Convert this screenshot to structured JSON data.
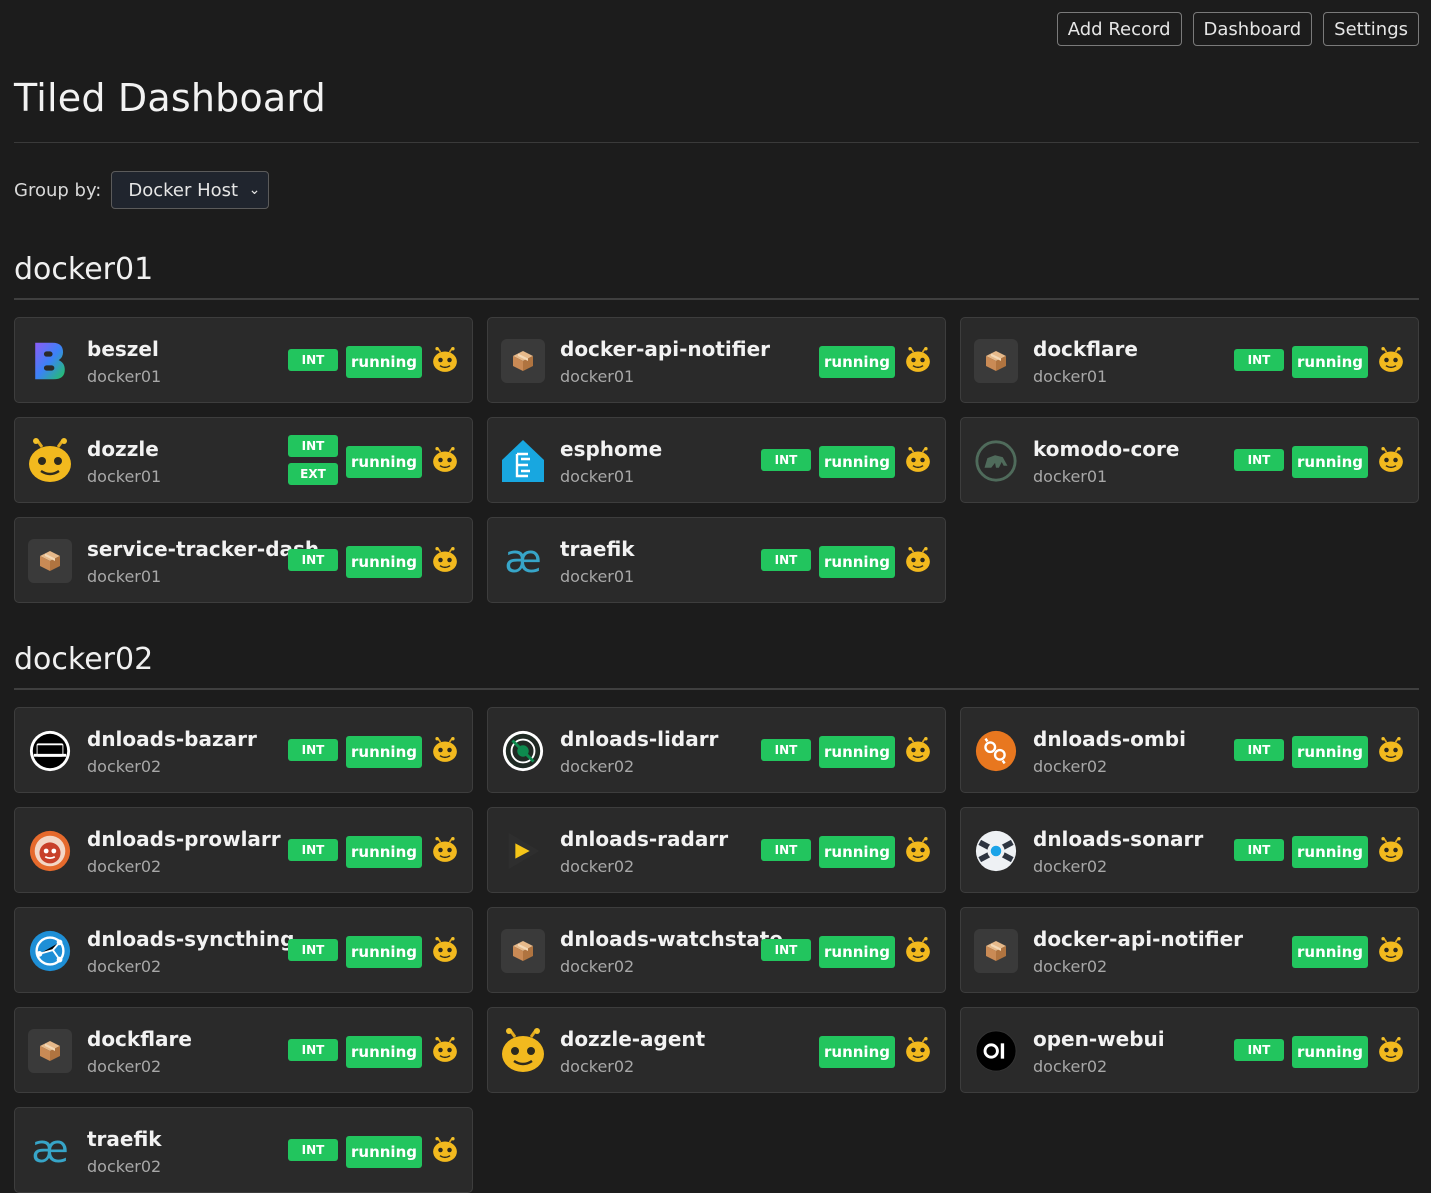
{
  "nav": {
    "add_record": "Add Record",
    "dashboard": "Dashboard",
    "settings": "Settings"
  },
  "page": {
    "title": "Tiled Dashboard"
  },
  "group_by": {
    "label": "Group by:",
    "value": "Docker Host"
  },
  "colors": {
    "accent_green": "#22c55e",
    "background": "#1c1c1c",
    "card": "#2a2a2a"
  },
  "groups": [
    {
      "title": "docker01",
      "cards": [
        {
          "name": "beszel",
          "host": "docker01",
          "icon": "beszel-icon",
          "tags": [
            "INT"
          ],
          "status": "running"
        },
        {
          "name": "docker-api-notifier",
          "host": "docker01",
          "icon": "package-icon",
          "tags": [],
          "status": "running"
        },
        {
          "name": "dockflare",
          "host": "docker01",
          "icon": "package-icon",
          "tags": [
            "INT"
          ],
          "status": "running"
        },
        {
          "name": "dozzle",
          "host": "docker01",
          "icon": "dozzle-icon",
          "tags": [
            "INT",
            "EXT"
          ],
          "status": "running"
        },
        {
          "name": "esphome",
          "host": "docker01",
          "icon": "esphome-icon",
          "tags": [
            "INT"
          ],
          "status": "running"
        },
        {
          "name": "komodo-core",
          "host": "docker01",
          "icon": "komodo-icon",
          "tags": [
            "INT"
          ],
          "status": "running"
        },
        {
          "name": "service-tracker-dash",
          "host": "docker01",
          "icon": "package-icon",
          "tags": [
            "INT"
          ],
          "status": "running"
        },
        {
          "name": "traefik",
          "host": "docker01",
          "icon": "traefik-icon",
          "tags": [
            "INT"
          ],
          "status": "running"
        }
      ]
    },
    {
      "title": "docker02",
      "cards": [
        {
          "name": "dnloads-bazarr",
          "host": "docker02",
          "icon": "bazarr-icon",
          "tags": [
            "INT"
          ],
          "status": "running"
        },
        {
          "name": "dnloads-lidarr",
          "host": "docker02",
          "icon": "lidarr-icon",
          "tags": [
            "INT"
          ],
          "status": "running"
        },
        {
          "name": "dnloads-ombi",
          "host": "docker02",
          "icon": "ombi-icon",
          "tags": [
            "INT"
          ],
          "status": "running"
        },
        {
          "name": "dnloads-prowlarr",
          "host": "docker02",
          "icon": "prowlarr-icon",
          "tags": [
            "INT"
          ],
          "status": "running"
        },
        {
          "name": "dnloads-radarr",
          "host": "docker02",
          "icon": "radarr-icon",
          "tags": [
            "INT"
          ],
          "status": "running"
        },
        {
          "name": "dnloads-sonarr",
          "host": "docker02",
          "icon": "sonarr-icon",
          "tags": [
            "INT"
          ],
          "status": "running"
        },
        {
          "name": "dnloads-syncthing",
          "host": "docker02",
          "icon": "syncthing-icon",
          "tags": [
            "INT"
          ],
          "status": "running"
        },
        {
          "name": "dnloads-watchstate",
          "host": "docker02",
          "icon": "package-icon",
          "tags": [
            "INT"
          ],
          "status": "running"
        },
        {
          "name": "docker-api-notifier",
          "host": "docker02",
          "icon": "package-icon",
          "tags": [],
          "status": "running"
        },
        {
          "name": "dockflare",
          "host": "docker02",
          "icon": "package-icon",
          "tags": [
            "INT"
          ],
          "status": "running"
        },
        {
          "name": "dozzle-agent",
          "host": "docker02",
          "icon": "dozzle-icon",
          "tags": [],
          "status": "running"
        },
        {
          "name": "open-webui",
          "host": "docker02",
          "icon": "openwebui-icon",
          "tags": [
            "INT"
          ],
          "status": "running"
        },
        {
          "name": "traefik",
          "host": "docker02",
          "icon": "traefik-icon",
          "tags": [
            "INT"
          ],
          "status": "running"
        }
      ]
    }
  ]
}
